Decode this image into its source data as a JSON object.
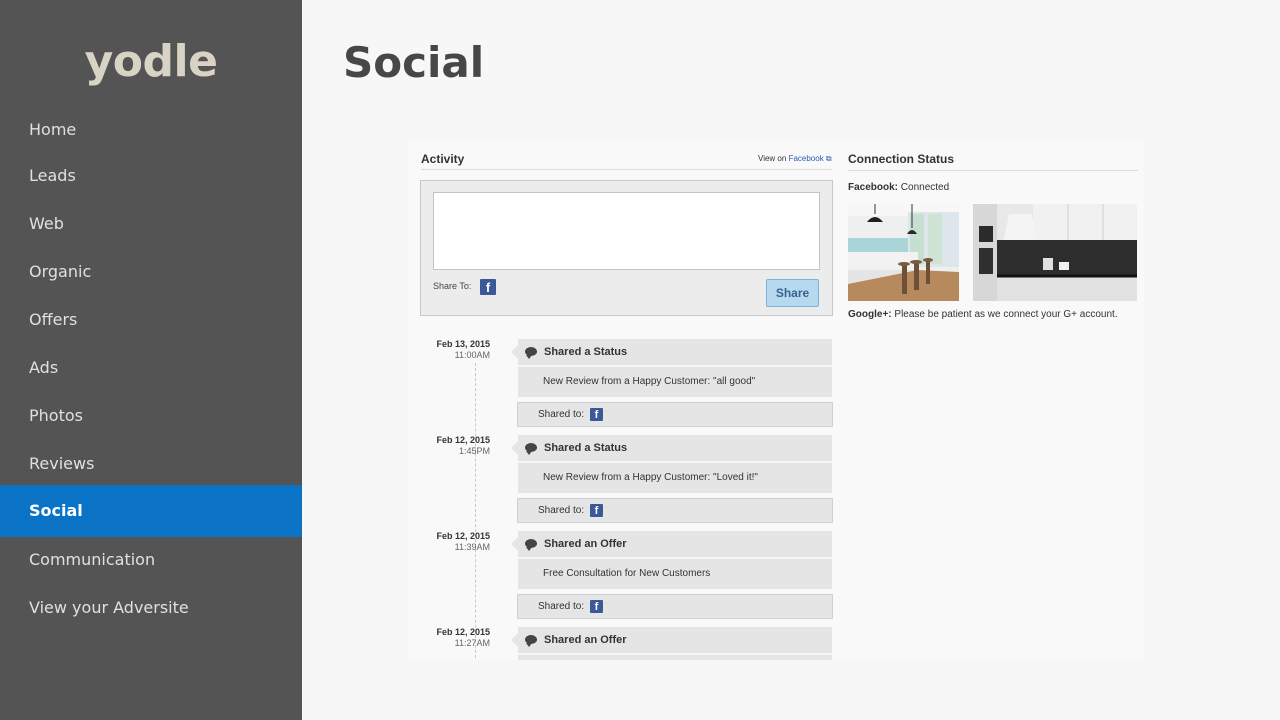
{
  "sidebar": {
    "logo": "yodle",
    "items": [
      {
        "label": "Home"
      },
      {
        "label": "Leads"
      },
      {
        "label": "Web"
      },
      {
        "label": "Organic"
      },
      {
        "label": "Offers"
      },
      {
        "label": "Ads"
      },
      {
        "label": "Photos"
      },
      {
        "label": "Reviews"
      },
      {
        "label": "Social",
        "active": true
      },
      {
        "label": "Communication"
      },
      {
        "label": "View your Adversite"
      }
    ]
  },
  "page": {
    "title": "Social"
  },
  "activity": {
    "title": "Activity",
    "view_on_prefix": "View on",
    "view_on_link": "Facebook",
    "composer": {
      "placeholder": "",
      "share_to_label": "Share To:",
      "share_button": "Share"
    },
    "posts": [
      {
        "date": "Feb 13, 2015",
        "time": "11:00AM",
        "type": "Shared a Status",
        "content": "New Review from a Happy Customer: \"all good\"",
        "shared_to": "Shared to:"
      },
      {
        "date": "Feb 12, 2015",
        "time": "1:45PM",
        "type": "Shared a Status",
        "content": "New Review from a Happy Customer: \"Loved it!\"",
        "shared_to": "Shared to:"
      },
      {
        "date": "Feb 12, 2015",
        "time": "11:39AM",
        "type": "Shared an Offer",
        "content": "Free Consultation for New Customers",
        "shared_to": "Shared to:"
      },
      {
        "date": "Feb 12, 2015",
        "time": "11:27AM",
        "type": "Shared an Offer"
      }
    ]
  },
  "connection": {
    "title": "Connection Status",
    "facebook_label": "Facebook:",
    "facebook_status": "Connected",
    "google_label": "Google+:",
    "google_status": "Please be patient as we connect your G+ account."
  },
  "icons": {
    "facebook": "facebook-icon",
    "comment": "speech-bubble-icon"
  },
  "colors": {
    "sidebar": "#545454",
    "active": "#0a73c6",
    "facebook": "#3b5998",
    "share_button": "#b7d9ef"
  }
}
